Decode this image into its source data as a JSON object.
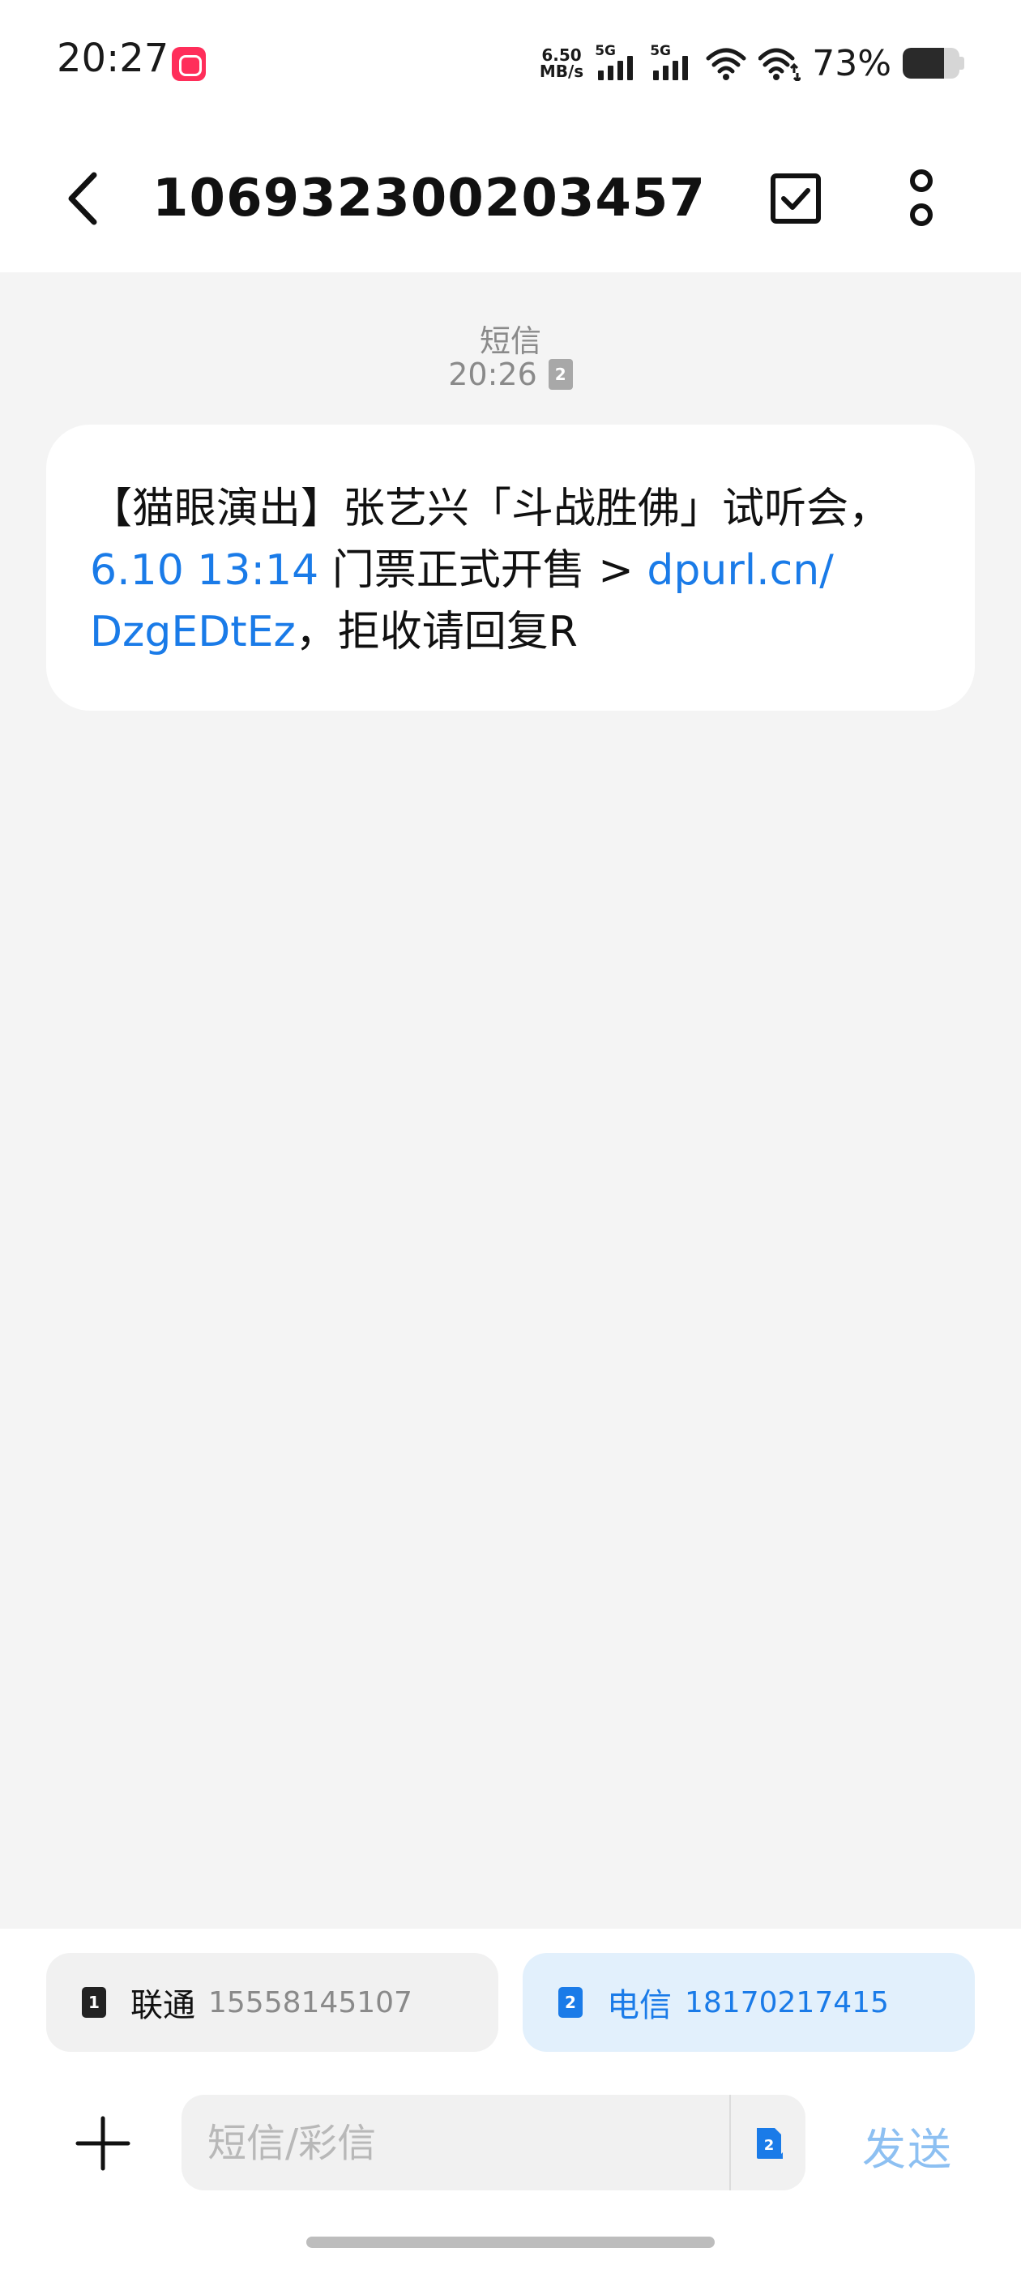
{
  "status_bar": {
    "time": "20:27",
    "speed_value": "6.50",
    "speed_unit": "MB/s",
    "sim1_network": "5G",
    "sim2_network": "5G",
    "battery_percent": "73%",
    "battery_level": 0.73
  },
  "header": {
    "title": "106932300203457"
  },
  "conversation": {
    "message_type": "短信",
    "time": "20:26",
    "sim_badge": "2",
    "message": {
      "part1": "【猫眼演出】张艺兴「斗战胜佛」试听会，",
      "datetime_link": "6.10 13:14",
      "part2": "门票正式开售 > ",
      "url_link": "dpurl.cn/\nDzgEDtEz",
      "part3": "，拒收请回复R"
    }
  },
  "sim_selector": {
    "sim1": {
      "badge": "1",
      "name": "联通",
      "number": "15558145107"
    },
    "sim2": {
      "badge": "2",
      "name": "电信",
      "number": "18170217415"
    }
  },
  "composer": {
    "placeholder": "短信/彩信",
    "sim_badge": "2",
    "send_label": "发送"
  },
  "colors": {
    "accent": "#1a7be8",
    "send_disabled": "#8dc0f2",
    "background": "#f4f4f4"
  }
}
